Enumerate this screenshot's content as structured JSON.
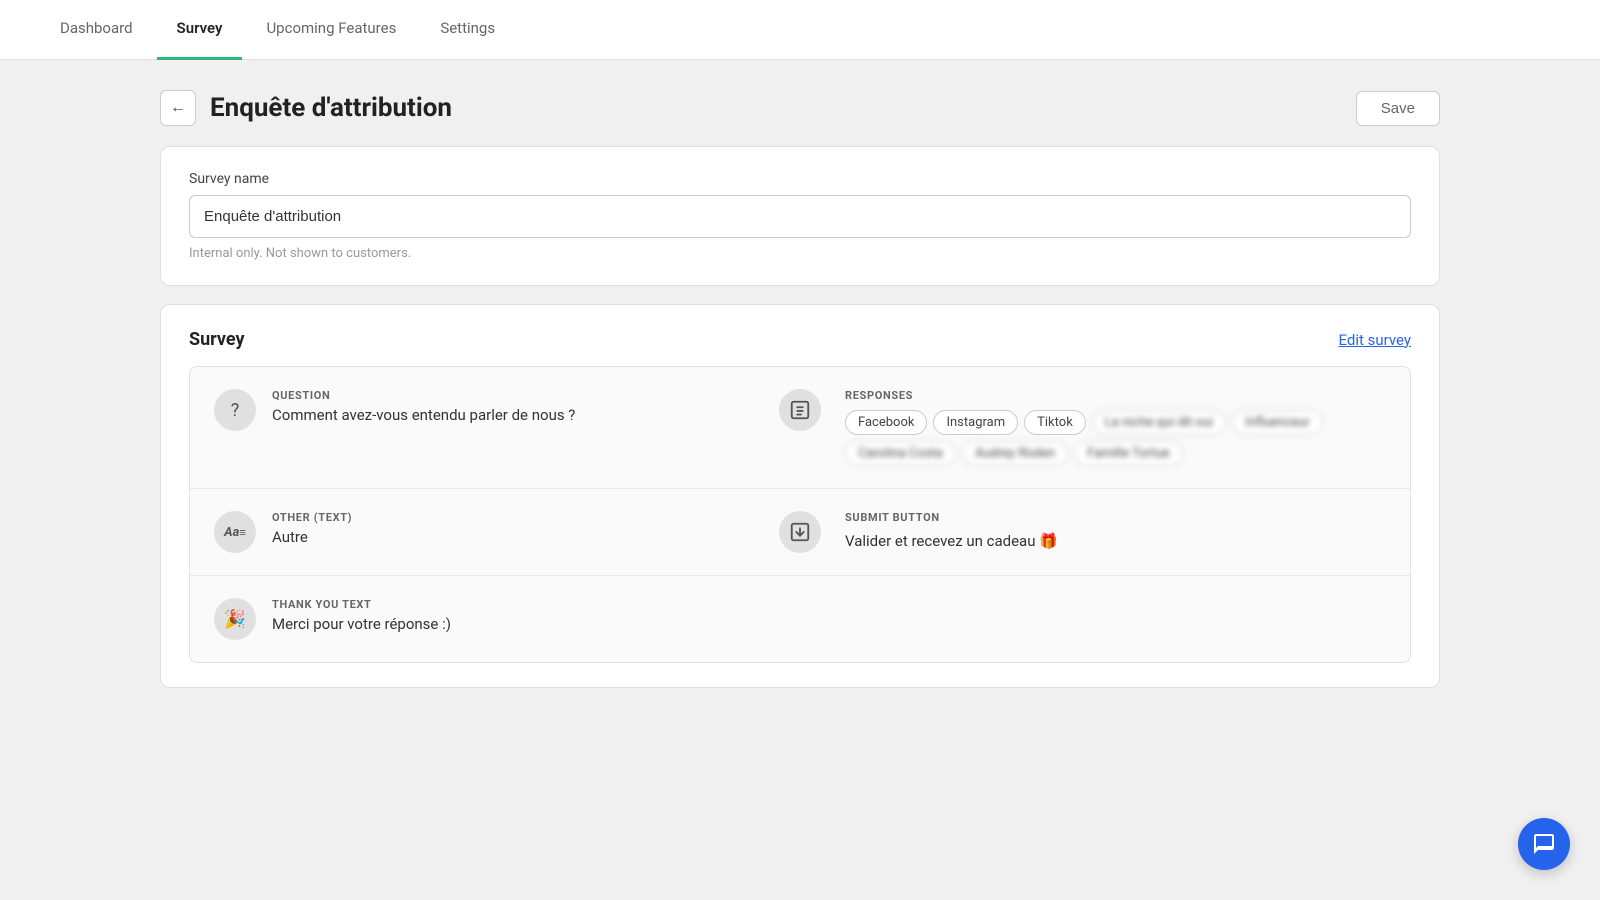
{
  "nav": {
    "tabs": [
      {
        "id": "dashboard",
        "label": "Dashboard",
        "active": false
      },
      {
        "id": "survey",
        "label": "Survey",
        "active": true
      },
      {
        "id": "upcoming",
        "label": "Upcoming Features",
        "active": false
      },
      {
        "id": "settings",
        "label": "Settings",
        "active": false
      }
    ]
  },
  "page": {
    "back_icon": "←",
    "title": "Enquête d'attribution",
    "save_label": "Save"
  },
  "survey_name_card": {
    "label": "Survey name",
    "input_value": "Enquête d'attribution",
    "hint": "Internal only. Not shown to customers."
  },
  "survey_section": {
    "title": "Survey",
    "edit_label": "Edit survey"
  },
  "question_row": {
    "icon": "?",
    "row_label": "QUESTION",
    "row_value": "Comment avez-vous entendu parler de nous ?",
    "mid_icon": "📋",
    "responses_label": "RESPONSES",
    "responses": [
      {
        "label": "Facebook",
        "blurred": false
      },
      {
        "label": "Instagram",
        "blurred": false
      },
      {
        "label": "Tiktok",
        "blurred": false
      },
      {
        "label": "La niche qui dit oui",
        "blurred": true
      },
      {
        "label": "Influenceur",
        "blurred": true
      },
      {
        "label": "Carolina Costa",
        "blurred": true
      },
      {
        "label": "Audrey Roden",
        "blurred": true
      },
      {
        "label": "Famille Tortue",
        "blurred": true
      }
    ]
  },
  "other_row": {
    "icon": "Aa",
    "row_label": "OTHER (TEXT)",
    "row_value": "Autre",
    "mid_icon": "↓",
    "submit_label": "SUBMIT BUTTON",
    "submit_value": "Valider et recevez un cadeau 🎁"
  },
  "thankyou_row": {
    "icon": "🎉",
    "row_label": "THANK YOU TEXT",
    "row_value": "Merci pour votre réponse :)"
  },
  "icons": {
    "back": "←",
    "chat": "💬"
  }
}
